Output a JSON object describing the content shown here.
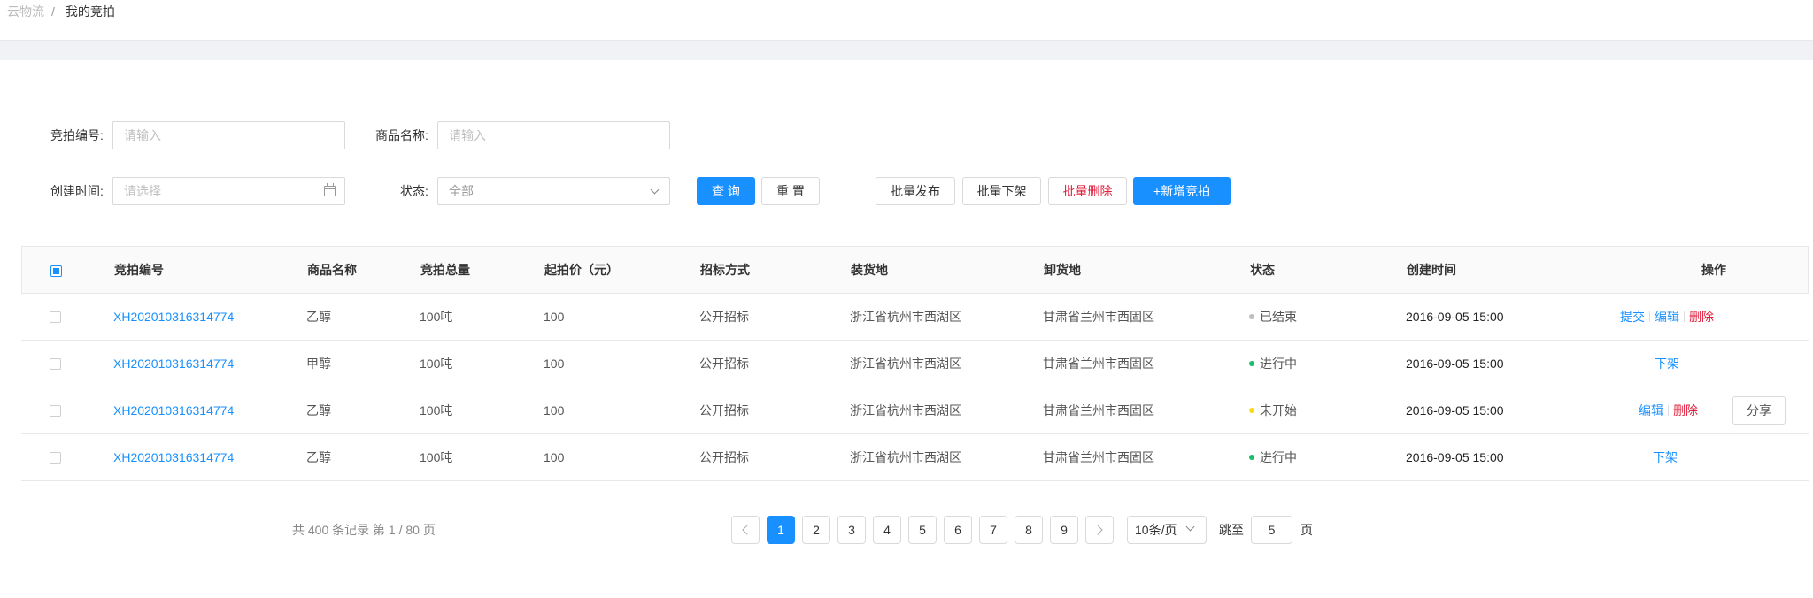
{
  "breadcrumb": {
    "root": "云物流",
    "separator": "/",
    "current": "我的竞拍"
  },
  "filters": {
    "auction_no": {
      "label": "竞拍编号:",
      "placeholder": "请输入"
    },
    "product_name": {
      "label": "商品名称:",
      "placeholder": "请输入"
    },
    "created_time": {
      "label": "创建时间:",
      "placeholder": "请选择"
    },
    "status": {
      "label": "状态:",
      "value": "全部"
    }
  },
  "buttons": {
    "query": "查 询",
    "reset": "重 置",
    "batch_publish": "批量发布",
    "batch_unlist": "批量下架",
    "batch_delete": "批量删除",
    "add_auction": "+新增竞拍"
  },
  "table": {
    "headers": {
      "auction_no": "竞拍编号",
      "product": "商品名称",
      "quantity": "竞拍总量",
      "start_price": "起拍价（元）",
      "bid_method": "招标方式",
      "load_place": "装货地",
      "unload_place": "卸货地",
      "status": "状态",
      "created": "创建时间",
      "ops": "操作"
    },
    "rows": [
      {
        "auction_no": "XH202010316314774",
        "product": "乙醇",
        "quantity": "100吨",
        "start_price": "100",
        "bid_method": "公开招标",
        "load_place": "浙江省杭州市西湖区",
        "unload_place": "甘肃省兰州市西固区",
        "status": "已结束",
        "status_color": "#bfbfbf",
        "created": "2016-09-05 15:00",
        "ops": {
          "submit": "提交",
          "edit": "编辑",
          "delete": "删除"
        }
      },
      {
        "auction_no": "XH202010316314774",
        "product": "甲醇",
        "quantity": "100吨",
        "start_price": "100",
        "bid_method": "公开招标",
        "load_place": "浙江省杭州市西湖区",
        "unload_place": "甘肃省兰州市西固区",
        "status": "进行中",
        "status_color": "#19be6b",
        "created": "2016-09-05 15:00",
        "ops": {
          "unlist": "下架"
        }
      },
      {
        "auction_no": "XH202010316314774",
        "product": "乙醇",
        "quantity": "100吨",
        "start_price": "100",
        "bid_method": "公开招标",
        "load_place": "浙江省杭州市西湖区",
        "unload_place": "甘肃省兰州市西固区",
        "status": "未开始",
        "status_color": "#fadb14",
        "created": "2016-09-05 15:00",
        "ops": {
          "edit": "编辑",
          "delete": "删除",
          "share": "分享"
        }
      },
      {
        "auction_no": "XH202010316314774",
        "product": "乙醇",
        "quantity": "100吨",
        "start_price": "100",
        "bid_method": "公开招标",
        "load_place": "浙江省杭州市西湖区",
        "unload_place": "甘肃省兰州市西固区",
        "status": "进行中",
        "status_color": "#19be6b",
        "created": "2016-09-05 15:00",
        "ops": {
          "unlist": "下架"
        }
      }
    ]
  },
  "pagination": {
    "summary": "共 400 条记录 第 1 / 80 页",
    "pages": [
      "1",
      "2",
      "3",
      "4",
      "5",
      "6",
      "7",
      "8",
      "9"
    ],
    "current_page": "1",
    "page_size": "10条/页",
    "jump_label": "跳至",
    "jump_value": "5",
    "page_unit": "页"
  },
  "colors": {
    "primary": "#1890ff",
    "danger": "#e01e3c"
  }
}
